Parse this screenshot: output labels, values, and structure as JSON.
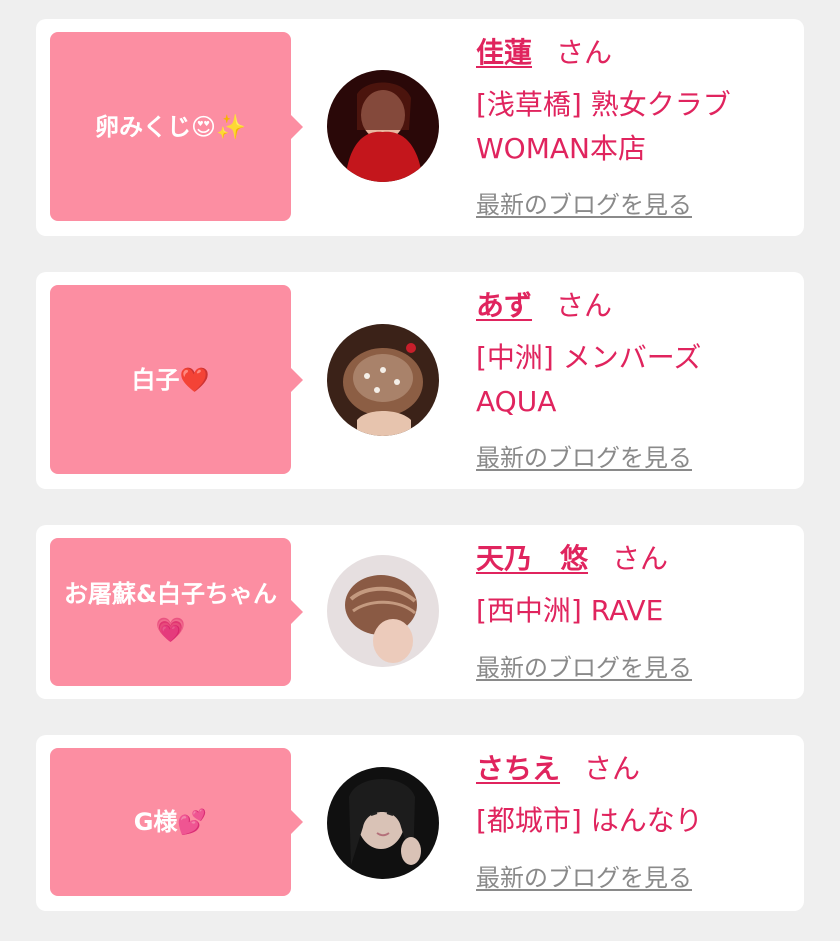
{
  "cards": [
    {
      "message": "卵みくじ😍✨",
      "name": "佳蓮",
      "honorific": "さん",
      "shop_lines": [
        "[浅草橋] 熟女クラブ",
        "WOMAN本店"
      ],
      "blog_link": "最新のブログを見る",
      "avatar_colors": [
        "#2a0808",
        "#c4161c"
      ]
    },
    {
      "message": "白子❤️",
      "name": "あず",
      "honorific": "さん",
      "shop_lines": [
        "[中洲] メンバーズ",
        "AQUA"
      ],
      "blog_link": "最新のブログを見る",
      "avatar_colors": [
        "#3b2218",
        "#a9826a"
      ]
    },
    {
      "message": "お屠蘇&白子ちゃん💗",
      "name": "天乃　悠",
      "honorific": "さん",
      "shop_lines": [
        "[西中洲] RAVE"
      ],
      "blog_link": "最新のブログを見る",
      "avatar_colors": [
        "#e6dfe0",
        "#8a5a44"
      ]
    },
    {
      "message": "G様💕",
      "name": "さちえ",
      "honorific": "さん",
      "shop_lines": [
        "[都城市] はんなり"
      ],
      "blog_link": "最新のブログを見る",
      "avatar_colors": [
        "#101010",
        "#d9c2b6"
      ]
    }
  ]
}
